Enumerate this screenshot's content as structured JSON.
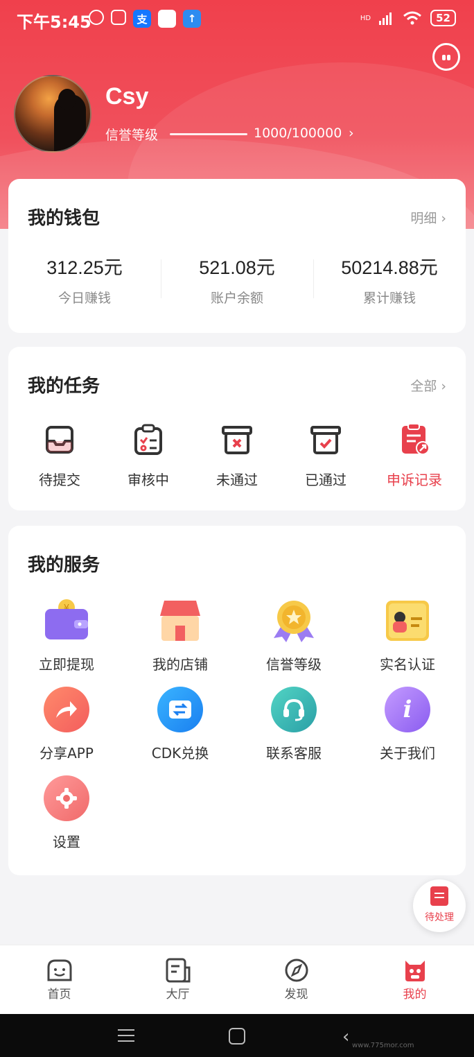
{
  "status_bar": {
    "time": "下午5:45",
    "battery": "52",
    "network": "HD"
  },
  "profile": {
    "username": "Csy",
    "credit_label": "信誉等级",
    "credit_value": "1000/100000",
    "credit_progress": 0.01
  },
  "wallet": {
    "title": "我的钱包",
    "detail_label": "明细",
    "stats": [
      {
        "value": "312.25元",
        "label": "今日赚钱"
      },
      {
        "value": "521.08元",
        "label": "账户余额"
      },
      {
        "value": "50214.88元",
        "label": "累计赚钱"
      }
    ]
  },
  "tasks": {
    "title": "我的任务",
    "all_label": "全部",
    "items": [
      {
        "label": "待提交",
        "icon": "inbox-icon"
      },
      {
        "label": "审核中",
        "icon": "clipboard-check-icon"
      },
      {
        "label": "未通过",
        "icon": "box-x-icon"
      },
      {
        "label": "已通过",
        "icon": "box-check-icon"
      },
      {
        "label": "申诉记录",
        "icon": "appeal-record-icon"
      }
    ]
  },
  "services": {
    "title": "我的服务",
    "items": [
      {
        "label": "立即提现",
        "icon": "wallet-icon"
      },
      {
        "label": "我的店铺",
        "icon": "shop-icon"
      },
      {
        "label": "信誉等级",
        "icon": "medal-icon"
      },
      {
        "label": "实名认证",
        "icon": "id-card-icon"
      },
      {
        "label": "分享APP",
        "icon": "share-icon"
      },
      {
        "label": "CDK兑换",
        "icon": "exchange-icon"
      },
      {
        "label": "联系客服",
        "icon": "headset-icon"
      },
      {
        "label": "关于我们",
        "icon": "info-icon"
      },
      {
        "label": "设置",
        "icon": "settings-icon"
      }
    ]
  },
  "pending_fab": {
    "label": "待处理"
  },
  "tabbar": {
    "items": [
      {
        "label": "首页",
        "icon": "home-face-icon"
      },
      {
        "label": "大厅",
        "icon": "hall-icon"
      },
      {
        "label": "发现",
        "icon": "compass-icon"
      },
      {
        "label": "我的",
        "icon": "profile-icon"
      }
    ],
    "active_index": 3
  },
  "colors": {
    "brand": "#e8404c",
    "header_top": "#f0404c"
  },
  "watermark": "www.775mor.com"
}
